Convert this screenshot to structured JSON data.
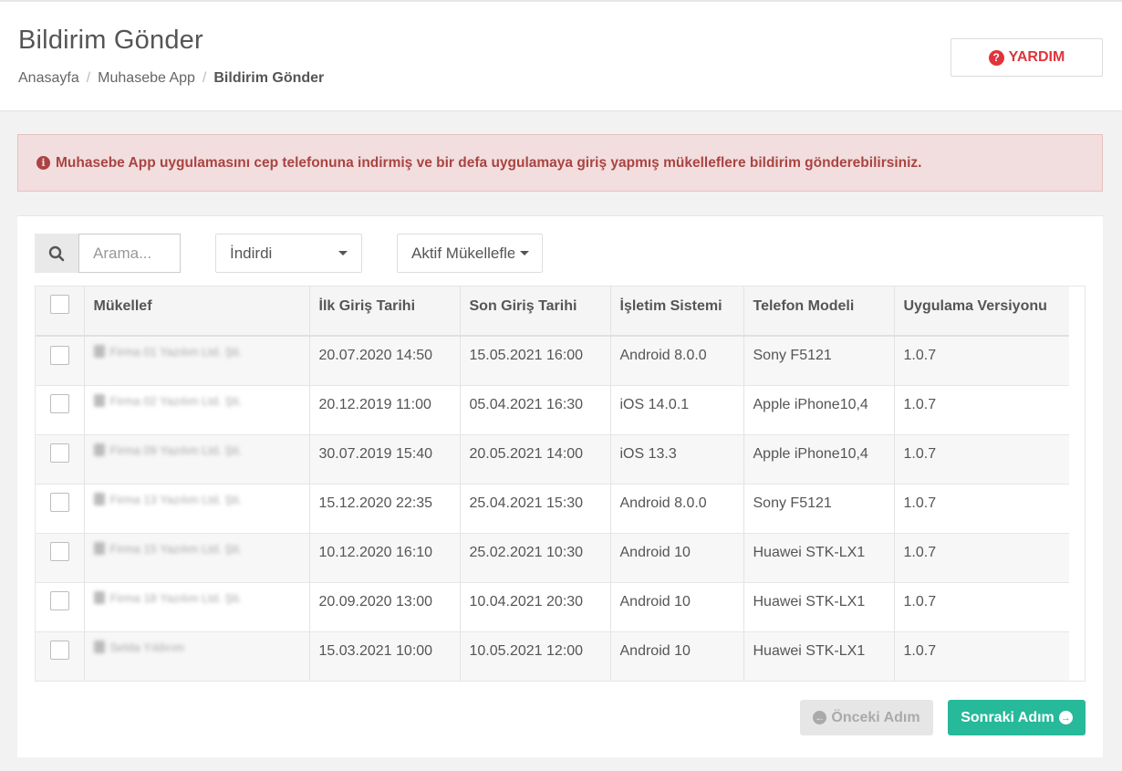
{
  "header": {
    "title": "Bildirim Gönder",
    "breadcrumb": [
      "Anasayfa",
      "Muhasebe App",
      "Bildirim Gönder"
    ],
    "help_label": "YARDIM",
    "help_icon": "question-circle-icon"
  },
  "alert": {
    "icon": "info-circle-icon",
    "text": "Muhasebe App uygulamasını cep telefonuna indirmiş ve bir defa uygulamaya giriş yapmış mükelleflere bildirim gönderebilirsiniz."
  },
  "filters": {
    "search_placeholder": "Arama...",
    "status_selected": "İndirdi",
    "taxpayer_filter_selected": "Aktif Mükellefler"
  },
  "table": {
    "columns": [
      "Mükellef",
      "İlk Giriş Tarihi",
      "Son Giriş Tarihi",
      "İşletim Sistemi",
      "Telefon Modeli",
      "Uygulama Versiyonu"
    ],
    "rows": [
      {
        "taxpayer": "Firma 01 Yazılım Ltd. Şti.",
        "first_login": "20.07.2020 14:50",
        "last_login": "15.05.2021 16:00",
        "os": "Android 8.0.0",
        "model": "Sony F5121",
        "version": "1.0.7"
      },
      {
        "taxpayer": "Firma 02 Yazılım Ltd. Şti.",
        "first_login": "20.12.2019 11:00",
        "last_login": "05.04.2021 16:30",
        "os": "iOS 14.0.1",
        "model": "Apple iPhone10,4",
        "version": "1.0.7"
      },
      {
        "taxpayer": "Firma 09 Yazılım Ltd. Şti.",
        "first_login": "30.07.2019 15:40",
        "last_login": "20.05.2021 14:00",
        "os": "iOS 13.3",
        "model": "Apple iPhone10,4",
        "version": "1.0.7"
      },
      {
        "taxpayer": "Firma 13 Yazılım Ltd. Şti.",
        "first_login": "15.12.2020 22:35",
        "last_login": "25.04.2021 15:30",
        "os": "Android 8.0.0",
        "model": "Sony F5121",
        "version": "1.0.7"
      },
      {
        "taxpayer": "Firma 15 Yazılım Ltd. Şti.",
        "first_login": "10.12.2020 16:10",
        "last_login": "25.02.2021 10:30",
        "os": "Android 10",
        "model": "Huawei STK-LX1",
        "version": "1.0.7"
      },
      {
        "taxpayer": "Firma 18 Yazılım Ltd. Şti.",
        "first_login": "20.09.2020 13:00",
        "last_login": "10.04.2021 20:30",
        "os": "Android 10",
        "model": "Huawei STK-LX1",
        "version": "1.0.7"
      },
      {
        "taxpayer": "Selda Yıldırım",
        "first_login": "15.03.2021 10:00",
        "last_login": "10.05.2021 12:00",
        "os": "Android 10",
        "model": "Huawei STK-LX1",
        "version": "1.0.7"
      }
    ]
  },
  "footer": {
    "prev_label": "Önceki Adım",
    "next_label": "Sonraki Adım",
    "accent_color": "#26b99a"
  }
}
